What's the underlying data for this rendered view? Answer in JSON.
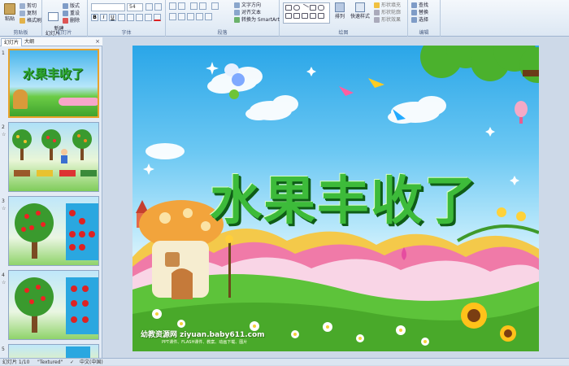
{
  "ribbon": {
    "clipboard": {
      "paste": "粘贴",
      "cut": "剪切",
      "copy": "复制",
      "format_painter": "格式刷",
      "group": "剪贴板"
    },
    "slides": {
      "new_slide": "新建\n幻灯片",
      "layout": "版式",
      "reset": "重设",
      "delete": "删除",
      "group": "幻灯片"
    },
    "font": {
      "font_name": "",
      "font_size": "54",
      "group": "字体"
    },
    "paragraph": {
      "text_direction": "文字方向",
      "align_text": "对齐文本",
      "smartart": "转换为 SmartArt",
      "group": "段落"
    },
    "drawing": {
      "arrange": "排列",
      "quick_styles": "快速样式",
      "shape_fill": "形状填充",
      "shape_outline": "形状轮廓",
      "shape_effects": "形状效果",
      "group": "绘图"
    },
    "editing": {
      "find": "查找",
      "replace": "替换",
      "select": "选择",
      "group": "编辑"
    }
  },
  "pane": {
    "tabs": [
      "幻灯片",
      "大纲"
    ],
    "thumbnails": [
      {
        "num": "1",
        "title": "水果丰收了"
      },
      {
        "num": "2"
      },
      {
        "num": "3"
      },
      {
        "num": "4"
      },
      {
        "num": "5"
      }
    ]
  },
  "slide": {
    "title": "水果丰收了",
    "footer": "幼教资源网 ziyuan.baby611.com",
    "footer_sub": "PPT课件、FLASH课件、教案、动画下载、图片"
  },
  "status": {
    "slide_info": "幻灯片 1/10",
    "theme": "\"Textured\"",
    "language": "中文(中国)"
  },
  "colors": {
    "title_green": "#3dbb3a",
    "title_shadow": "#0f5d17",
    "sky": "#2aa6e8",
    "grass": "#5dc33a",
    "ribbon_bg": "#dce7f3"
  }
}
